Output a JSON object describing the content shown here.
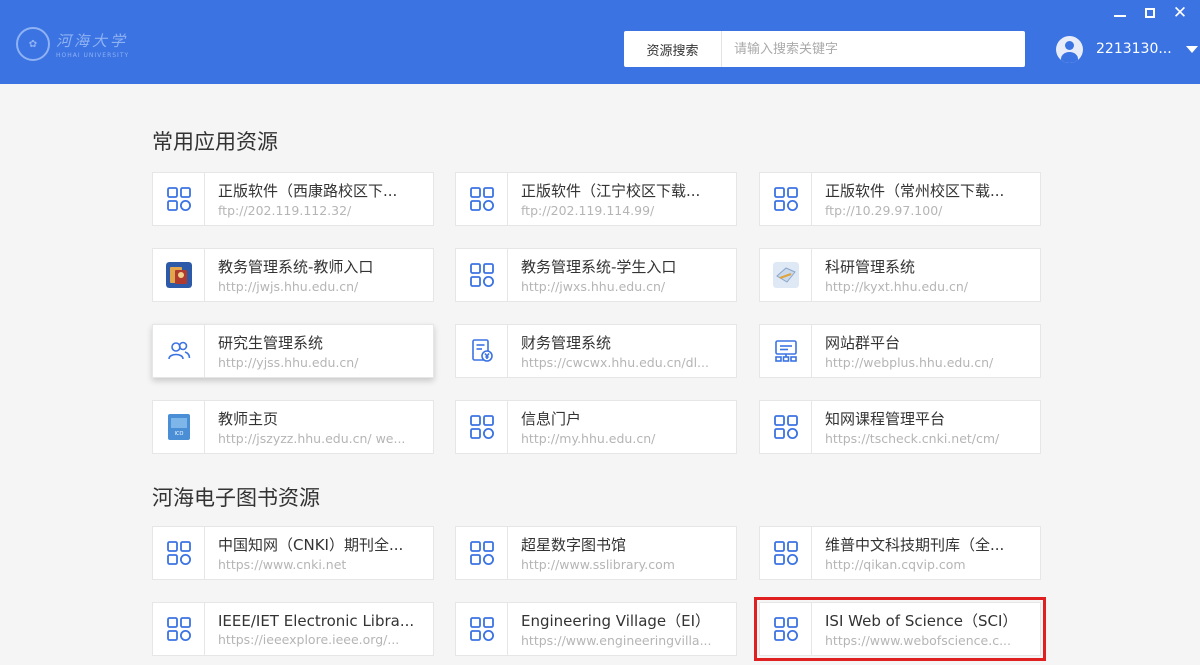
{
  "header": {
    "logo_cn": "河海大学",
    "logo_en": "HOHAI UNIVERSITY",
    "search_label": "资源搜索",
    "search_placeholder": "请输入搜索关键字",
    "username": "2213130..."
  },
  "colors": {
    "header_bg": "#3b73e3",
    "accent": "#3b73e3",
    "highlight": "#e02020"
  },
  "sections": [
    {
      "title": "常用应用资源",
      "items": [
        {
          "name": "正版软件（西康路校区下...",
          "url": "ftp://202.119.112.32/",
          "icon": "grid-icon"
        },
        {
          "name": "正版软件（江宁校区下载...",
          "url": "ftp://202.119.114.99/",
          "icon": "grid-icon"
        },
        {
          "name": "正版软件（常州校区下载...",
          "url": "ftp://10.29.97.100/",
          "icon": "grid-icon"
        },
        {
          "name": "教务管理系统-教师入口",
          "url": "http://jwjs.hhu.edu.cn/",
          "icon": "teacher-portal-icon"
        },
        {
          "name": "教务管理系统-学生入口",
          "url": "http://jwxs.hhu.edu.cn/",
          "icon": "grid-icon"
        },
        {
          "name": "科研管理系统",
          "url": "http://kyxt.hhu.edu.cn/",
          "icon": "research-icon"
        },
        {
          "name": "研究生管理系统",
          "url": "http://yjss.hhu.edu.cn/",
          "icon": "users-icon"
        },
        {
          "name": "财务管理系统",
          "url": "https://cwcwx.hhu.edu.cn/dl...",
          "icon": "finance-icon"
        },
        {
          "name": "网站群平台",
          "url": "http://webplus.hhu.edu.cn/",
          "icon": "website-icon"
        },
        {
          "name": "教师主页",
          "url": "http://jszyzz.hhu.edu.cn/  we...",
          "icon": "teacher-homepage-icon"
        },
        {
          "name": "信息门户",
          "url": "http://my.hhu.edu.cn/",
          "icon": "grid-icon"
        },
        {
          "name": "知网课程管理平台",
          "url": "https://tscheck.cnki.net/cm/",
          "icon": "grid-icon"
        }
      ]
    },
    {
      "title": "河海电子图书资源",
      "items": [
        {
          "name": "中国知网（CNKI）期刊全...",
          "url": "https://www.cnki.net",
          "icon": "grid-icon"
        },
        {
          "name": "超星数字图书馆",
          "url": "http://www.sslibrary.com",
          "icon": "grid-icon"
        },
        {
          "name": "维普中文科技期刊库（全...",
          "url": "http://qikan.cqvip.com",
          "icon": "grid-icon"
        },
        {
          "name": "IEEE/IET Electronic Libra...",
          "url": "https://ieeexplore.ieee.org/...",
          "icon": "grid-icon"
        },
        {
          "name": "Engineering Village（EI）",
          "url": "https://www.engineeringvilla...",
          "icon": "grid-icon"
        },
        {
          "name": "ISI Web of Science（SCI）",
          "url": "https://www.webofscience.c...",
          "icon": "grid-icon"
        }
      ]
    }
  ]
}
